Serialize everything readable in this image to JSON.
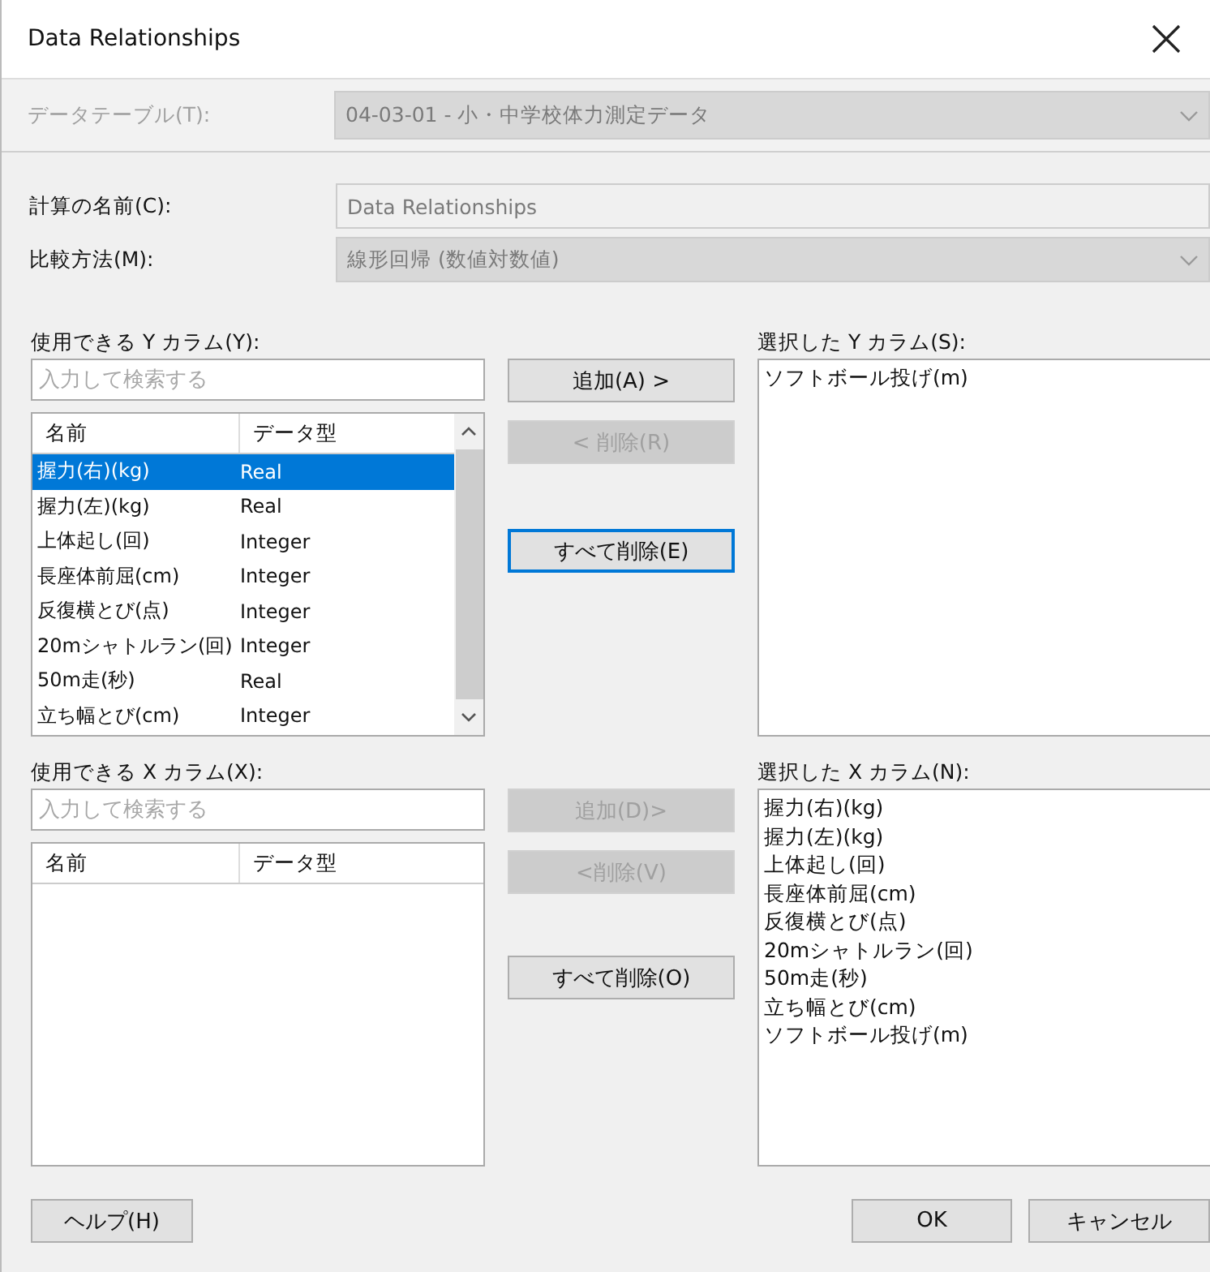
{
  "window": {
    "title": "Data Relationships"
  },
  "data_table": {
    "label": "データテーブル(T):",
    "value": "04-03-01 - 小・中学校体力測定データ",
    "disabled": true
  },
  "calc_name": {
    "label": "計算の名前(C):",
    "value": "Data Relationships",
    "disabled": true
  },
  "method": {
    "label": "比較方法(M):",
    "value": "線形回帰 (数値対数値)",
    "disabled": true
  },
  "sections": [
    {
      "available": {
        "label": "使用できる Y カラム(Y):",
        "placeholder": "入力して検索する",
        "columns": [
          "名前",
          "データ型"
        ],
        "scrollbar": true,
        "rows": [
          {
            "name": "握力(右)(kg)",
            "type": "Real",
            "selected": true
          },
          {
            "name": "握力(左)(kg)",
            "type": "Real",
            "selected": false
          },
          {
            "name": "上体起し(回)",
            "type": "Integer",
            "selected": false
          },
          {
            "name": "長座体前屈(cm)",
            "type": "Integer",
            "selected": false
          },
          {
            "name": "反復横とび(点)",
            "type": "Integer",
            "selected": false
          },
          {
            "name": "20mシャトルラン(回)",
            "type": "Integer",
            "selected": false
          },
          {
            "name": "50m走(秒)",
            "type": "Real",
            "selected": false
          },
          {
            "name": "立ち幅とび(cm)",
            "type": "Integer",
            "selected": false
          }
        ]
      },
      "buttons": [
        {
          "label": "追加(A) >",
          "disabled": false,
          "focused": false
        },
        {
          "label": "< 削除(R)",
          "disabled": true,
          "focused": false
        },
        {
          "label": "すべて削除(E)",
          "disabled": false,
          "focused": true
        }
      ],
      "selected": {
        "label": "選択した Y カラム(S):",
        "items": [
          "ソフトボール投げ(m)"
        ]
      }
    },
    {
      "available": {
        "label": "使用できる X カラム(X):",
        "placeholder": "入力して検索する",
        "columns": [
          "名前",
          "データ型"
        ],
        "scrollbar": false
      },
      "buttons": [
        {
          "label": "追加(D)>",
          "disabled": true,
          "focused": false
        },
        {
          "label": "<削除(V)",
          "disabled": true,
          "focused": false
        },
        {
          "label": "すべて削除(O)",
          "disabled": false,
          "focused": false
        }
      ],
      "selected": {
        "label": "選択した X カラム(N):",
        "items": [
          "握力(右)(kg)",
          "握力(左)(kg)",
          "上体起し(回)",
          "長座体前屈(cm)",
          "反復横とび(点)",
          "20mシャトルラン(回)",
          "50m走(秒)",
          "立ち幅とび(cm)",
          "ソフトボール投げ(m)"
        ]
      }
    }
  ],
  "footer": {
    "help": "ヘルプ(H)",
    "ok": "OK",
    "cancel": "キャンセル"
  }
}
